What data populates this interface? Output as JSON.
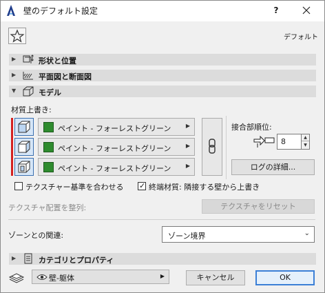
{
  "window": {
    "title": "壁のデフォルト設定",
    "help": "?",
    "close_icon": "close-icon",
    "app_icon": "archicad-logo"
  },
  "favorites": {
    "icon": "star-icon"
  },
  "default_label": "デフォルト",
  "sections": {
    "shape": {
      "label": "形状と位置",
      "expanded": false,
      "icon": "shape-position-icon"
    },
    "plan": {
      "label": "平面図と断面図",
      "expanded": false,
      "icon": "floor-plan-icon"
    },
    "model": {
      "label": "モデル",
      "expanded": true,
      "icon": "model-3d-icon"
    },
    "category": {
      "label": "カテゴリとプロパティ",
      "expanded": false,
      "icon": "category-icon"
    }
  },
  "model": {
    "surface_override_label": "材質上書き:",
    "materials": [
      {
        "name": "ペイント - フォーレストグリーン",
        "color": "#2e8b2e",
        "icon": "wall-face-icon"
      },
      {
        "name": "ペイント - フォーレストグリーン",
        "color": "#2e8b2e",
        "icon": "wall-side-icon"
      },
      {
        "name": "ペイント - フォーレストグリーン",
        "color": "#2e8b2e",
        "icon": "wall-opposite-icon"
      }
    ],
    "chain_icon": "chain-link-icon",
    "intersection_priority_label": "接合部順位:",
    "intersection_priority_value": "8",
    "log_details_button": "ログの詳細...",
    "align_texture_label": "テクスチャー基準を合わせる",
    "align_texture_checked": false,
    "edge_surface_label": "終端材質: 隣接する壁から上書き",
    "edge_surface_checked": true,
    "texture_align_label": "テクスチャ配置を整列:",
    "reset_texture_button": "テクスチャをリセット",
    "zone_relation_label": "ゾーンとの関連:",
    "zone_relation_value": "ゾーン境界"
  },
  "footer": {
    "layer_value": "壁-躯体",
    "cancel_button": "キャンセル",
    "ok_button": "OK"
  },
  "colors": {
    "accent_red": "#d42020",
    "ok_border": "#3b7fd6",
    "material_green": "#2e8b2e"
  }
}
